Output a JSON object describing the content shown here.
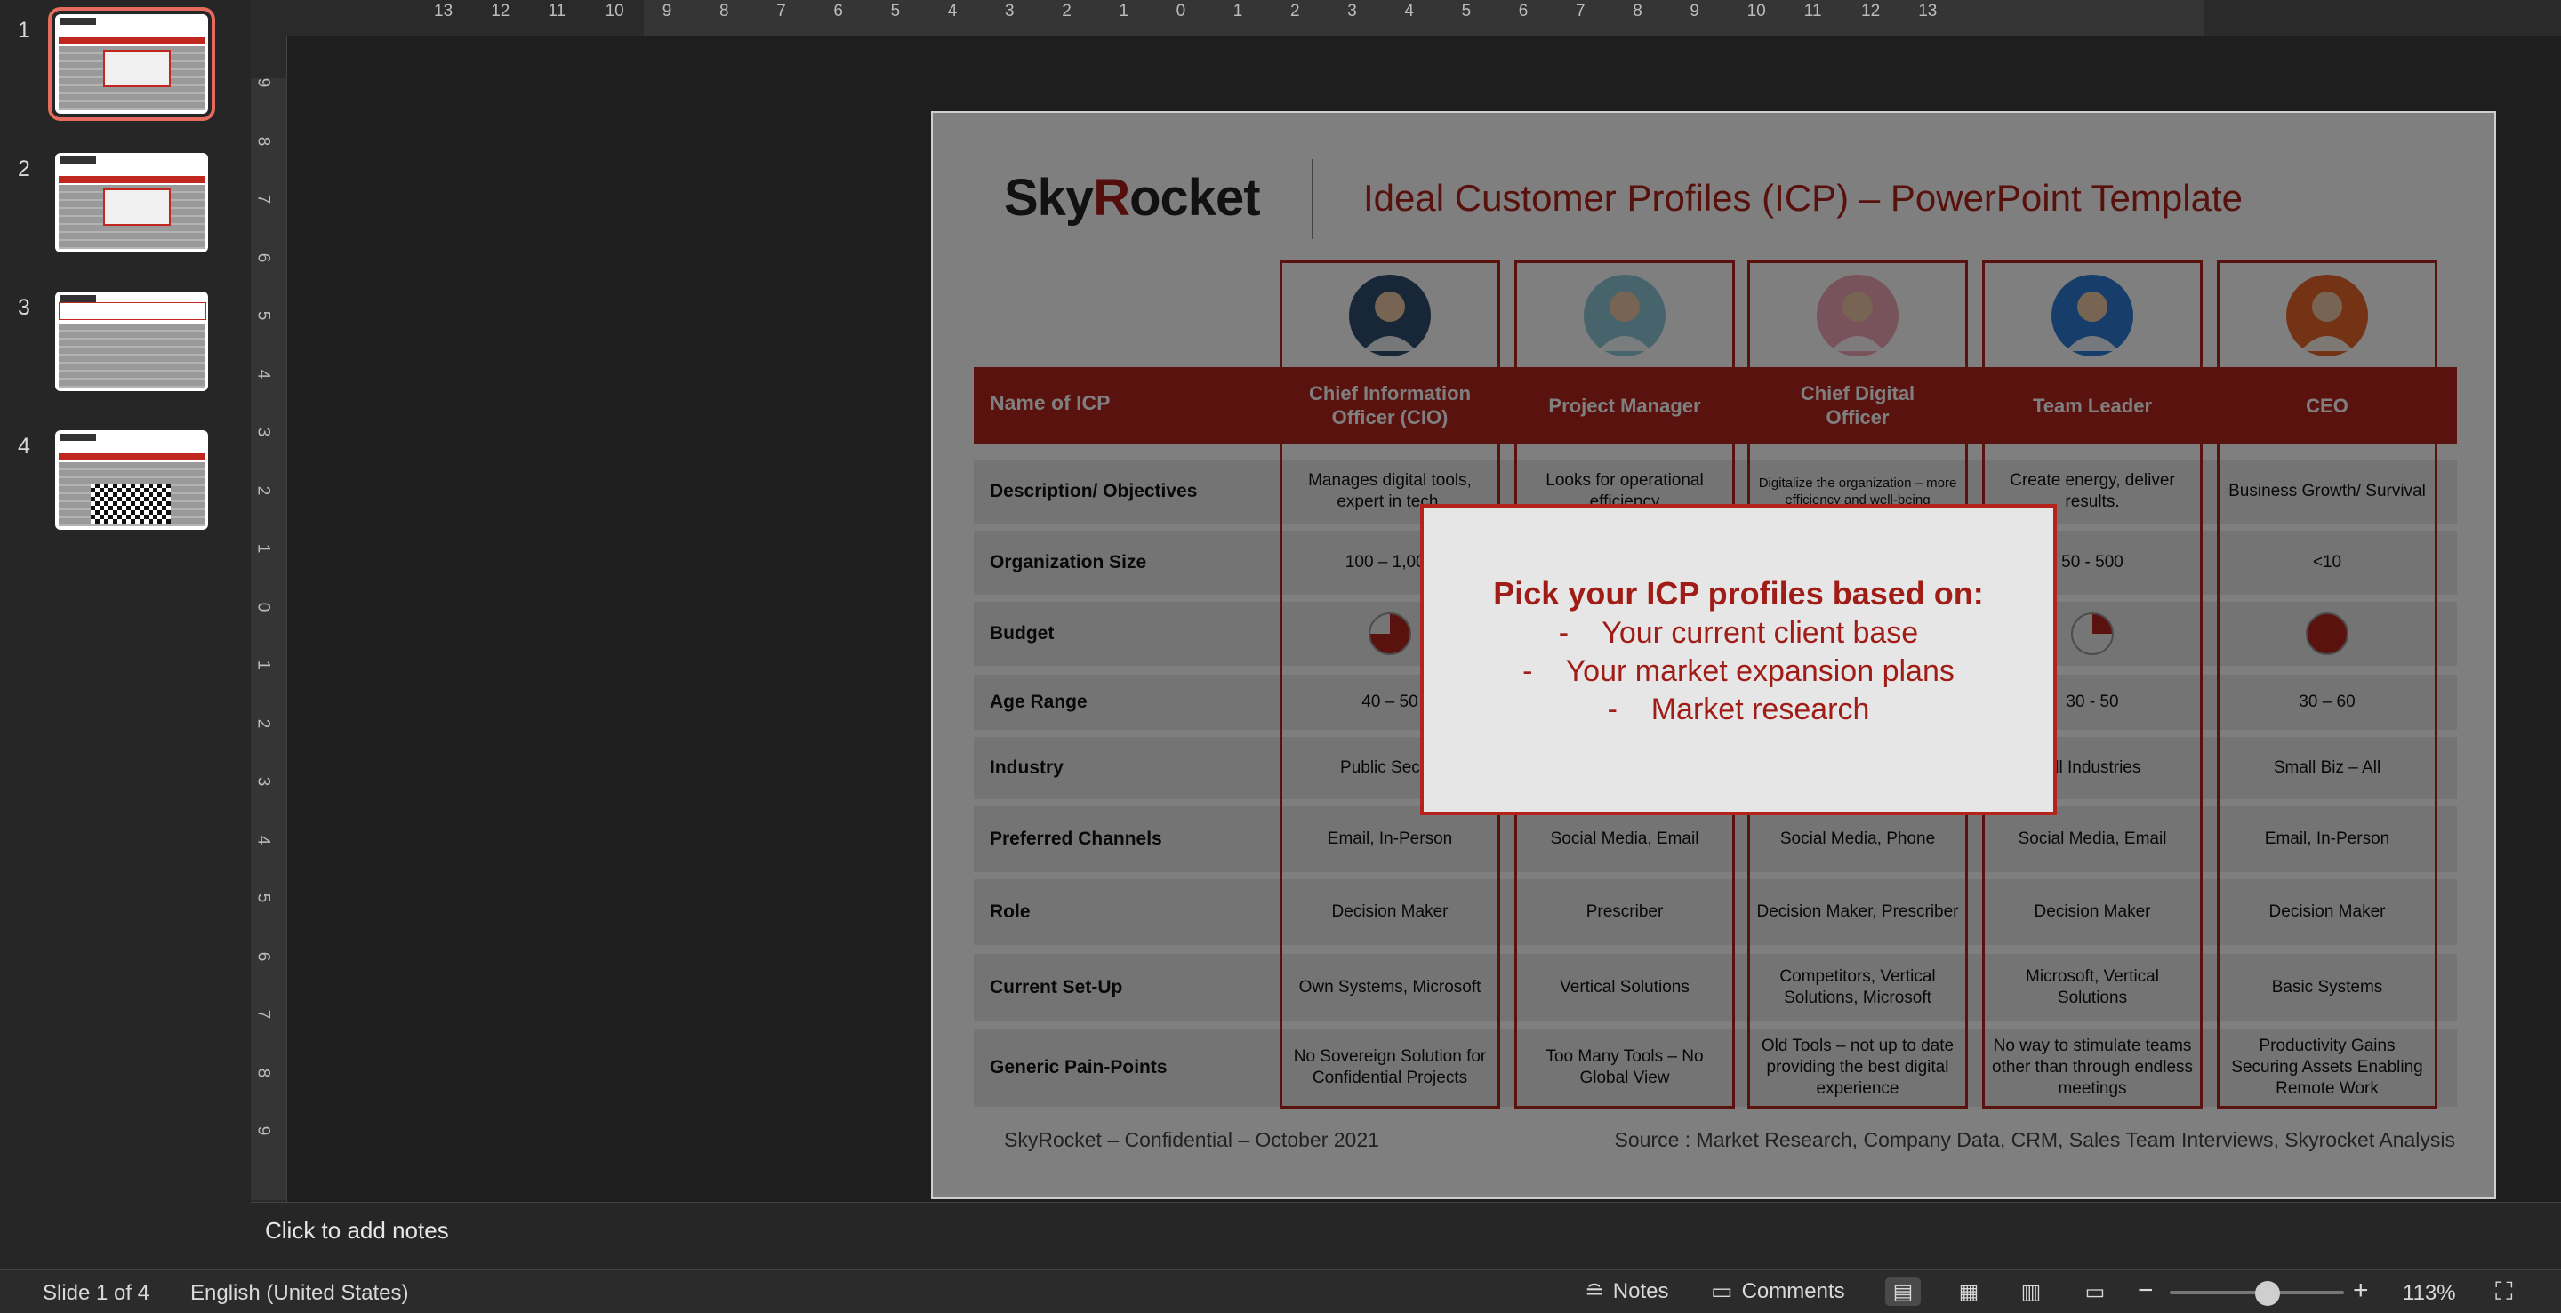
{
  "thumbnails": [
    {
      "num": "1",
      "selected": true
    },
    {
      "num": "2",
      "selected": false
    },
    {
      "num": "3",
      "selected": false
    },
    {
      "num": "4",
      "selected": false
    }
  ],
  "ruler": {
    "top_ticks": [
      "13",
      "12",
      "11",
      "10",
      "9",
      "8",
      "7",
      "6",
      "5",
      "4",
      "3",
      "2",
      "1",
      "0",
      "1",
      "2",
      "3",
      "4",
      "5",
      "6",
      "7",
      "8",
      "9",
      "10",
      "11",
      "12",
      "13"
    ],
    "left_ticks": [
      "9",
      "8",
      "7",
      "6",
      "5",
      "4",
      "3",
      "2",
      "1",
      "0",
      "1",
      "2",
      "3",
      "4",
      "5",
      "6",
      "7",
      "8",
      "9"
    ]
  },
  "slide": {
    "logo_pre": "Sky",
    "logo_r": "R",
    "logo_post": "ocket",
    "title": "Ideal Customer Profiles (ICP) – PowerPoint Template",
    "name_of_icp_label": "Name of ICP",
    "profiles": [
      {
        "title": "Chief Information Officer (CIO)",
        "avatar_color": "#2f4f6e"
      },
      {
        "title": "Project Manager",
        "avatar_color": "#8ec9d8"
      },
      {
        "title": "Chief Digital Officer",
        "avatar_color": "#f0a6b7"
      },
      {
        "title": "Team Leader",
        "avatar_color": "#2f7bd6"
      },
      {
        "title": "CEO",
        "avatar_color": "#e8662b"
      }
    ],
    "rows": [
      {
        "label": "Description/ Objectives",
        "values": [
          "Manages digital tools, expert in tech.",
          "Looks for operational efficiency",
          "Digitalize the organization – more efficiency and well-being",
          "Create energy, deliver results.",
          "Business Growth/ Survival"
        ]
      },
      {
        "label": "Organization Size",
        "values": [
          "100 – 1,000",
          "",
          "",
          "50 - 500",
          "<10"
        ]
      },
      {
        "label": "Budget",
        "values": [
          "",
          "",
          "",
          "",
          ""
        ],
        "pie_fractions": [
          0.75,
          0,
          0,
          0.25,
          1.0
        ]
      },
      {
        "label": "Age Range",
        "values": [
          "40 – 50",
          "",
          "",
          "30 - 50",
          "30 – 60"
        ]
      },
      {
        "label": "Industry",
        "values": [
          "Public Sector",
          "",
          "",
          "All Industries",
          "Small Biz – All"
        ]
      },
      {
        "label": "Preferred Channels",
        "values": [
          "Email, In-Person",
          "Social Media, Email",
          "Social Media, Phone",
          "Social Media, Email",
          "Email, In-Person"
        ]
      },
      {
        "label": "Role",
        "values": [
          "Decision Maker",
          "Prescriber",
          "Decision Maker, Prescriber",
          "Decision Maker",
          "Decision Maker"
        ]
      },
      {
        "label": "Current Set-Up",
        "values": [
          "Own Systems, Microsoft",
          "Vertical Solutions",
          "Competitors, Vertical Solutions, Microsoft",
          "Microsoft, Vertical Solutions",
          "Basic Systems"
        ]
      },
      {
        "label": "Generic Pain-Points",
        "values": [
          "No Sovereign Solution for Confidential Projects",
          "Too Many Tools – No Global View",
          "Old Tools – not up to date providing the best digital experience",
          "No way to stimulate teams other than through endless meetings",
          "Productivity Gains Securing Assets Enabling Remote Work"
        ]
      }
    ],
    "footer_left": "SkyRocket – Confidential – October 2021",
    "footer_right": "Source : Market Research, Company Data, CRM, Sales Team Interviews, Skyrocket Analysis",
    "popup": {
      "heading": "Pick your ICP profiles based on:",
      "items": [
        "-    Your current client base",
        "-    Your market expansion plans",
        "-    Market research"
      ]
    }
  },
  "notes_placeholder": "Click to add notes",
  "status": {
    "slide_info": "Slide 1 of 4",
    "language": "English (United States)",
    "notes_label": "Notes",
    "comments_label": "Comments",
    "zoom": "113%",
    "zoom_level": 0.56
  },
  "colors": {
    "accent": "#b4241c",
    "thumb_selected": "#e56b5f"
  }
}
